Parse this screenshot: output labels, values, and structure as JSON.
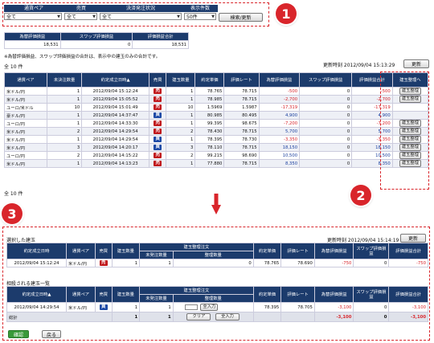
{
  "filters": {
    "headers": [
      "通貨ペア",
      "売買",
      "決済発注状況",
      "表示件数"
    ],
    "values": [
      "全て",
      "全て",
      "全て",
      "50件"
    ],
    "search_button": "検索/更新"
  },
  "summary": {
    "headers": [
      "為替評価損益",
      "スワップ評価損益",
      "評価損益合計"
    ],
    "values": [
      "18,531",
      "0",
      "18,531"
    ],
    "note": "※為替評価損益、スワップ評価損益の合計は、表示中の建玉のみの合計です。"
  },
  "list": {
    "count_top": "全 10 件",
    "count_bottom": "全 10 件",
    "updated": "更新時刻 2012/09/04 15:13:29",
    "refresh": "更新",
    "columns": [
      "通貨ペア",
      "未決注数量",
      "約定成立日時▲",
      "売買",
      "建玉数量",
      "約定単価",
      "評価レート",
      "為替評価損益",
      "スワップ評価損益",
      "評価損益合計",
      "建玉整理へ"
    ],
    "action_label": "建玉整理",
    "rows": [
      {
        "pair": "米ドル/円",
        "unsettled": "1",
        "date": "2012/09/04 15:12:24",
        "side": "売",
        "qty": "1",
        "price": "78.765",
        "rate": "78.715",
        "fx": "-500",
        "swap": "0",
        "total": "-500",
        "action": true
      },
      {
        "pair": "米ドル/円",
        "unsettled": "1",
        "date": "2012/09/04 15:05:52",
        "side": "売",
        "qty": "1",
        "price": "78.985",
        "rate": "78.715",
        "fx": "-2,700",
        "swap": "0",
        "total": "-2,700",
        "action": true
      },
      {
        "pair": "ユーロ/米ドル",
        "unsettled": "10",
        "date": "2012/09/04 15:01:49",
        "side": "売",
        "qty": "10",
        "price": "1.5969",
        "rate": "1.5987",
        "fx": "-17,319",
        "swap": "0",
        "total": "-17,319",
        "action": false
      },
      {
        "pair": "豪ドル/円",
        "unsettled": "1",
        "date": "2012/09/04 14:37:47",
        "side": "買",
        "qty": "1",
        "price": "80.985",
        "rate": "80.495",
        "fx": "4,900",
        "swap": "0",
        "total": "4,900",
        "action": false
      },
      {
        "pair": "ユーロ/円",
        "unsettled": "1",
        "date": "2012/09/04 14:33:30",
        "side": "売",
        "qty": "1",
        "price": "99.395",
        "rate": "98.675",
        "fx": "-7,200",
        "swap": "0",
        "total": "-7,200",
        "action": true
      },
      {
        "pair": "米ドル/円",
        "unsettled": "2",
        "date": "2012/09/04 14:29:54",
        "side": "売",
        "qty": "2",
        "price": "78.430",
        "rate": "78.715",
        "fx": "5,700",
        "swap": "0",
        "total": "5,700",
        "action": true
      },
      {
        "pair": "米ドル/円",
        "unsettled": "1",
        "date": "2012/09/04 14:29:54",
        "side": "買",
        "qty": "1",
        "price": "78.395",
        "rate": "78.730",
        "fx": "-3,350",
        "swap": "0",
        "total": "-3,350",
        "action": true
      },
      {
        "pair": "米ドル/円",
        "unsettled": "3",
        "date": "2012/09/04 14:20:17",
        "side": "買",
        "qty": "3",
        "price": "78.110",
        "rate": "78.715",
        "fx": "18,150",
        "swap": "0",
        "total": "18,150",
        "action": true
      },
      {
        "pair": "ユーロ/円",
        "unsettled": "2",
        "date": "2012/09/04 14:15:22",
        "side": "売",
        "qty": "2",
        "price": "99.215",
        "rate": "98.690",
        "fx": "10,500",
        "swap": "0",
        "total": "10,500",
        "action": true
      },
      {
        "pair": "米ドル/円",
        "unsettled": "1",
        "date": "2012/09/04 14:13:23",
        "side": "売",
        "qty": "1",
        "price": "77.880",
        "rate": "78.715",
        "fx": "8,350",
        "swap": "0",
        "total": "8,350",
        "action": true
      }
    ]
  },
  "selected": {
    "title": "選択した建玉",
    "updated": "更新時刻 2012/09/04 15:14:19",
    "refresh": "更新",
    "columns": [
      "約定成立日時",
      "通貨ペア",
      "売買",
      "建玉数量",
      "建玉整理注文",
      "未発注数量",
      "整理数量",
      "約定単価",
      "評価レート",
      "為替評価損益",
      "スワップ評価損益",
      "評価損益合計"
    ],
    "row": {
      "date": "2012/09/04 15:12:24",
      "pair": "米ドル/円",
      "side": "売",
      "qty": "1",
      "unsettled": "1",
      "settle": "0",
      "price": "78.765",
      "rate": "78.690",
      "fx": "-750",
      "swap": "0",
      "total": "-750"
    }
  },
  "offset": {
    "title": "相殺される建玉一覧",
    "columns": [
      "約定成立日時▲",
      "通貨ペア",
      "売買",
      "建玉数量",
      "建玉整理注文",
      "未発注数量",
      "整理数量",
      "約定単価",
      "評価レート",
      "為替評価損益",
      "スワップ評価損益",
      "評価損益合計"
    ],
    "row": {
      "date": "2012/09/04 14:29:54",
      "pair": "米ドル/円",
      "side": "買",
      "qty": "1",
      "unsettled": "1",
      "settle": "",
      "all_input": "全入力",
      "price": "78.395",
      "rate": "78.705",
      "fx": "-3,100",
      "swap": "0",
      "total": "-3,100"
    },
    "total_row": {
      "label": "総計",
      "qty": "1",
      "unsettled": "1",
      "fx": "-3,100",
      "swap": "0",
      "total": "-3,100"
    },
    "clear": "クリア",
    "all_input": "全入力"
  },
  "footer": {
    "confirm": "確認",
    "back": "戻る"
  },
  "callouts": [
    "1",
    "2",
    "3"
  ],
  "colors": {
    "header": "#1c3b6c",
    "sell": "#c0181c",
    "buy": "#1d4aa6",
    "callout": "#d9252b",
    "confirm": "#3a9a3a"
  }
}
